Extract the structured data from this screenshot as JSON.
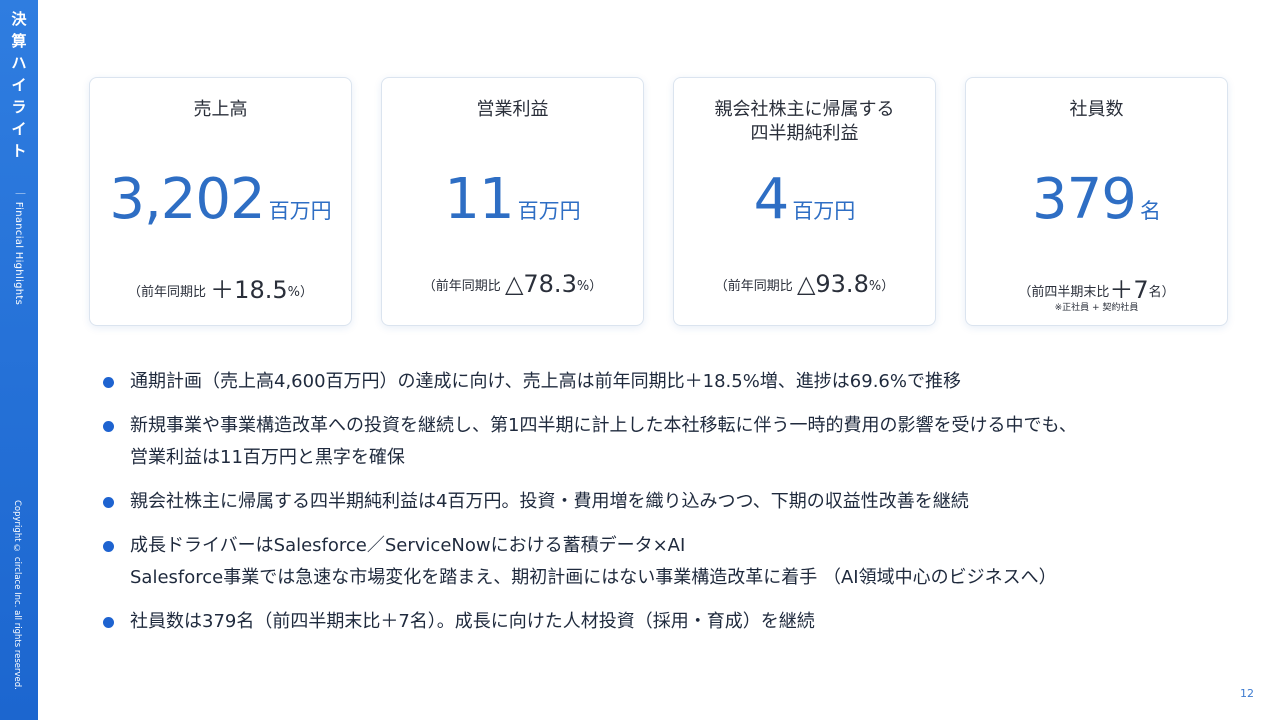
{
  "sidebar": {
    "title_chars": [
      "決",
      "算",
      "ハ",
      "イ",
      "ラ",
      "イ",
      "ト"
    ],
    "divider": "｜",
    "subtitle": "Financial Highlights",
    "copyright": "Copyright © circlace Inc. all rights reserved."
  },
  "cards": [
    {
      "title": "売上高",
      "value": "3,202",
      "unit": "百万円",
      "compare_prefix": "（前年同期比",
      "compare_value": "＋18.5",
      "compare_suffix": "%）",
      "note": ""
    },
    {
      "title": "営業利益",
      "value": "11",
      "unit": "百万円",
      "compare_prefix": "（前年同期比",
      "compare_value": "△78.3",
      "compare_suffix": "%）",
      "note": ""
    },
    {
      "title": "親会社株主に帰属する\n四半期純利益",
      "value": "4",
      "unit": "百万円",
      "compare_prefix": "（前年同期比",
      "compare_value": "△93.8",
      "compare_suffix": "%）",
      "note": ""
    },
    {
      "title": "社員数",
      "value": "379",
      "unit": "名",
      "compare_prefix": "（前四半期末比",
      "compare_value": "＋7",
      "compare_suffix": "名）",
      "note": "※正社員 + 契約社員"
    }
  ],
  "bullets": [
    [
      "通期計画（売上高4,600百万円）の達成に向け、売上高は前年同期比＋18.5%増、進捗は69.6%で推移"
    ],
    [
      "新規事業や事業構造改革への投資を継続し、第1四半期に計上した本社移転に伴う一時的費用の影響を受ける中でも、",
      "営業利益は11百万円と黒字を確保"
    ],
    [
      "親会社株主に帰属する四半期純利益は4百万円。投資・費用増を織り込みつつ、下期の収益性改善を継続"
    ],
    [
      "成長ドライバーはSalesforce／ServiceNowにおける蓄積データ×AI",
      "Salesforce事業では急速な市場変化を踏まえ、期初計画にはない事業構造改革に着手 （AI領域中心のビジネスへ）"
    ],
    [
      "社員数は379名（前四半期末比＋7名）。成長に向けた人材投資（採用・育成）を継続"
    ]
  ],
  "page_number": "12",
  "colors": {
    "accent": "#1e63d0",
    "value": "#2e6ec4",
    "sidebar": "#2f7de0"
  }
}
